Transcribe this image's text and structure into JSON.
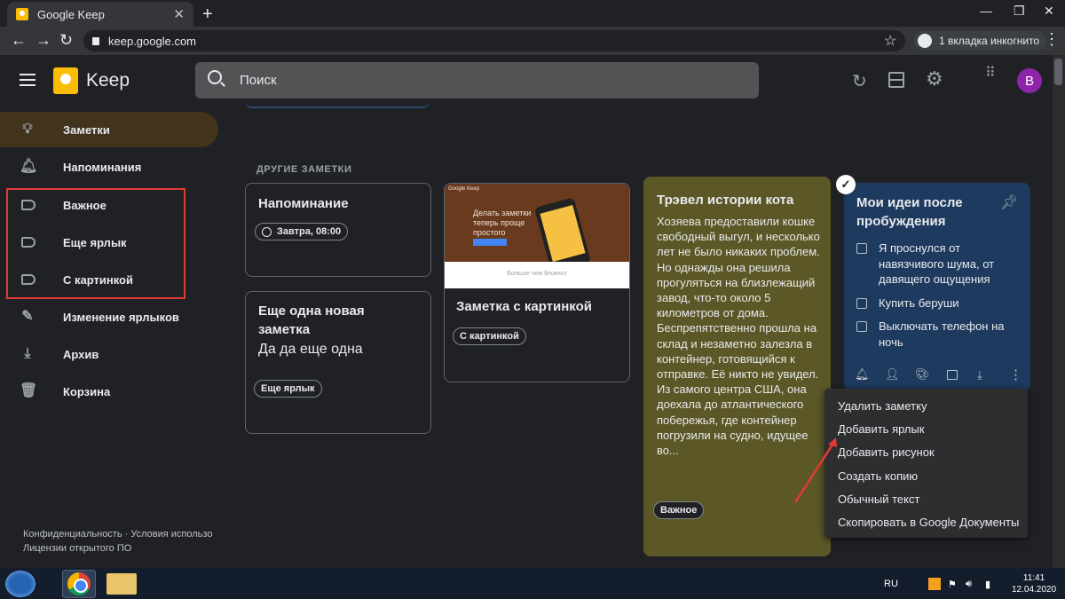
{
  "browser": {
    "tab_title": "Google Keep",
    "tab_close": "✕",
    "new_tab": "+",
    "url": "keep.google.com",
    "incognito_label": "1 вкладка инкогнито",
    "window_controls": [
      "—",
      "❐",
      "✕"
    ]
  },
  "header": {
    "app_name": "Keep",
    "search_placeholder": "Поиск",
    "avatar_letter": "B",
    "icons": [
      "refresh-icon",
      "list-view-icon",
      "settings-icon",
      "apps-icon"
    ]
  },
  "sidebar": {
    "items": [
      {
        "label": "Заметки",
        "icon": "lightbulb-icon",
        "active": true
      },
      {
        "label": "Напоминания",
        "icon": "bell-icon"
      },
      {
        "label": "Важное",
        "icon": "label-icon"
      },
      {
        "label": "Еще ярлык",
        "icon": "label-icon"
      },
      {
        "label": "С картинкой",
        "icon": "label-icon"
      },
      {
        "label": "Изменение ярлыков",
        "icon": "pencil-icon"
      },
      {
        "label": "Архив",
        "icon": "archive-icon"
      },
      {
        "label": "Корзина",
        "icon": "trash-icon"
      }
    ],
    "footer_line1": "Конфиденциальность  ·  Условия использо",
    "footer_line2": "Лицензии открытого ПО"
  },
  "main": {
    "section_label": "ДРУГИЕ ЗАМЕТКИ",
    "notes": {
      "reminder": {
        "title": "Напоминание",
        "chip": "Завтра, 08:00"
      },
      "another": {
        "title": "Еще одна новая заметка",
        "body": "Да да еще одна",
        "chip": "Еще ярлык"
      },
      "image_note": {
        "title": "Заметка с картинкой",
        "chip": "С картинкой",
        "thumb_header": "Google Keep",
        "thumb_text": "Делать заметки теперь проще простого",
        "thumb_footer": "Больше чем блокнот"
      },
      "cat_story": {
        "title": "Трэвел истории кота",
        "body": "Хозяева предоставили кошке свободный выгул, и несколько лет не было никаких проблем. Но однажды она решила прогуляться на близлежащий завод, что-то около 5 километров от дома. Беспрепятственно прошла на склад и незаметно залезла в контейнер, готовящийся к отправке. Её никто не увидел. Из самого центра США, она доехала до атлантического побережья, где контейнер погрузили на судно, идущее во...",
        "chip": "Важное",
        "bg": "#5b5726"
      },
      "ideas": {
        "title": "Мои идеи после пробуждения",
        "bg": "#1e3a5f",
        "items": [
          "Я проснулся от навязчивого шума, от давящего ощущения",
          "Купить беруши",
          "Выключать телефон на ночь"
        ]
      }
    },
    "context_menu": [
      "Удалить заметку",
      "Добавить ярлык",
      "Добавить рисунок",
      "Создать копию",
      "Обычный текст",
      "Скопировать в Google Документы"
    ]
  },
  "taskbar": {
    "lang": "RU",
    "time": "11:41",
    "date": "12.04.2020"
  }
}
